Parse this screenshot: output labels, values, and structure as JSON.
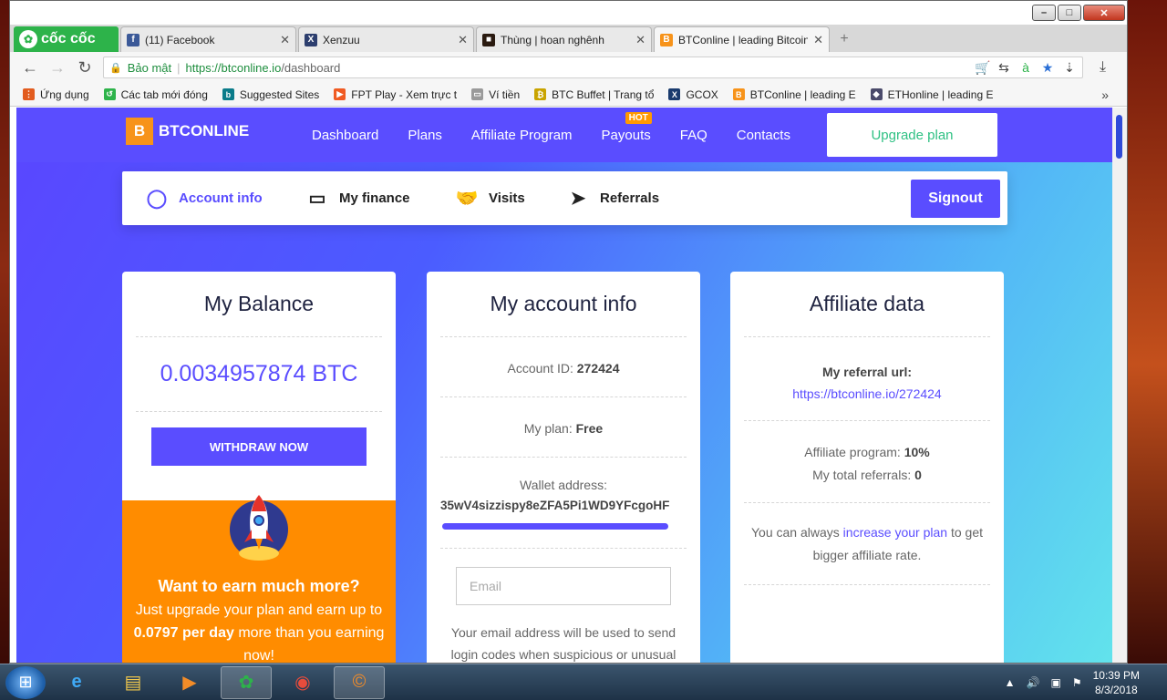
{
  "browser": {
    "logo_label": "cốc cốc",
    "tabs": [
      {
        "title": "(11) Facebook",
        "icon": "facebook-icon",
        "color": "#3b5998",
        "glyph": "f"
      },
      {
        "title": "Xenzuu",
        "icon": "xenzuu-icon",
        "color": "#2c3e6e",
        "glyph": "X"
      },
      {
        "title": "Thùng | hoan nghênh",
        "icon": "thung-icon",
        "color": "#2a1a10",
        "glyph": "■"
      },
      {
        "title": "BTConline | leading Bitcoin",
        "icon": "btconline-icon",
        "color": "#f7931a",
        "glyph": "B"
      }
    ],
    "secure_label": "Bảo mật",
    "url_host": "https://btconline.io",
    "url_path": "/dashboard",
    "bookmarks": [
      {
        "label": "Ứng dụng",
        "icon": "apps-icon",
        "color": "#e25c1f",
        "glyph": "⋮"
      },
      {
        "label": "Các tab mới đóng",
        "icon": "history-icon",
        "color": "#2db34a",
        "glyph": "↺"
      },
      {
        "label": "Suggested Sites",
        "icon": "bing-icon",
        "color": "#0b7c8a",
        "glyph": "b"
      },
      {
        "label": "FPT Play - Xem trực t",
        "icon": "fptplay-icon",
        "color": "#f05a22",
        "glyph": "▶"
      },
      {
        "label": "Ví tiền",
        "icon": "page-icon",
        "color": "#9a9a9a",
        "glyph": "▭"
      },
      {
        "label": "BTC Buffet | Trang tổ",
        "icon": "btcbuffet-icon",
        "color": "#c9a400",
        "glyph": "₿"
      },
      {
        "label": "GCOX",
        "icon": "gcox-icon",
        "color": "#1a3b6e",
        "glyph": "X"
      },
      {
        "label": "BTConline | leading E",
        "icon": "btconline-bm-icon",
        "color": "#f7931a",
        "glyph": "B"
      },
      {
        "label": "ETHonline | leading E",
        "icon": "ethonline-icon",
        "color": "#4a4a6a",
        "glyph": "◆"
      }
    ]
  },
  "site": {
    "brand": "BTCONLINE",
    "brand_glyph": "B",
    "nav": [
      "Dashboard",
      "Plans",
      "Affiliate Program",
      "Payouts",
      "FAQ",
      "Contacts"
    ],
    "hot_badge": "HOT",
    "upgrade": "Upgrade plan",
    "subnav": {
      "account": "Account info",
      "finance": "My finance",
      "visits": "Visits",
      "referrals": "Referrals",
      "signout": "Signout"
    }
  },
  "balance": {
    "title": "My Balance",
    "amount": "0.0034957874 BTC",
    "withdraw": "WITHDRAW NOW",
    "promo_heading": "Want to earn much more?",
    "promo_text_1": "Just upgrade your plan and earn up to",
    "promo_amount": "0.0797 per day",
    "promo_text_2": "more than you earning now!"
  },
  "account": {
    "title": "My account info",
    "id_label": "Account ID:",
    "id_value": "272424",
    "plan_label": "My plan:",
    "plan_value": "Free",
    "wallet_label": "Wallet address:",
    "wallet_value": "35wV4sizzispy8eZFA5Pi1WD9YFcgoHF",
    "email_placeholder": "Email",
    "email_note": "Your email address will be used to send login codes when suspicious or unusual"
  },
  "affiliate": {
    "title": "Affiliate data",
    "ref_label": "My referral url:",
    "ref_url": "https://btconline.io/272424",
    "program_label": "Affiliate program:",
    "program_value": "10%",
    "referrals_label": "My total referrals:",
    "referrals_value": "0",
    "note_1": "You can always",
    "note_link": "increase your plan",
    "note_2": "to get bigger affiliate rate."
  },
  "taskbar": {
    "time": "10:39 PM",
    "date": "8/3/2018"
  }
}
